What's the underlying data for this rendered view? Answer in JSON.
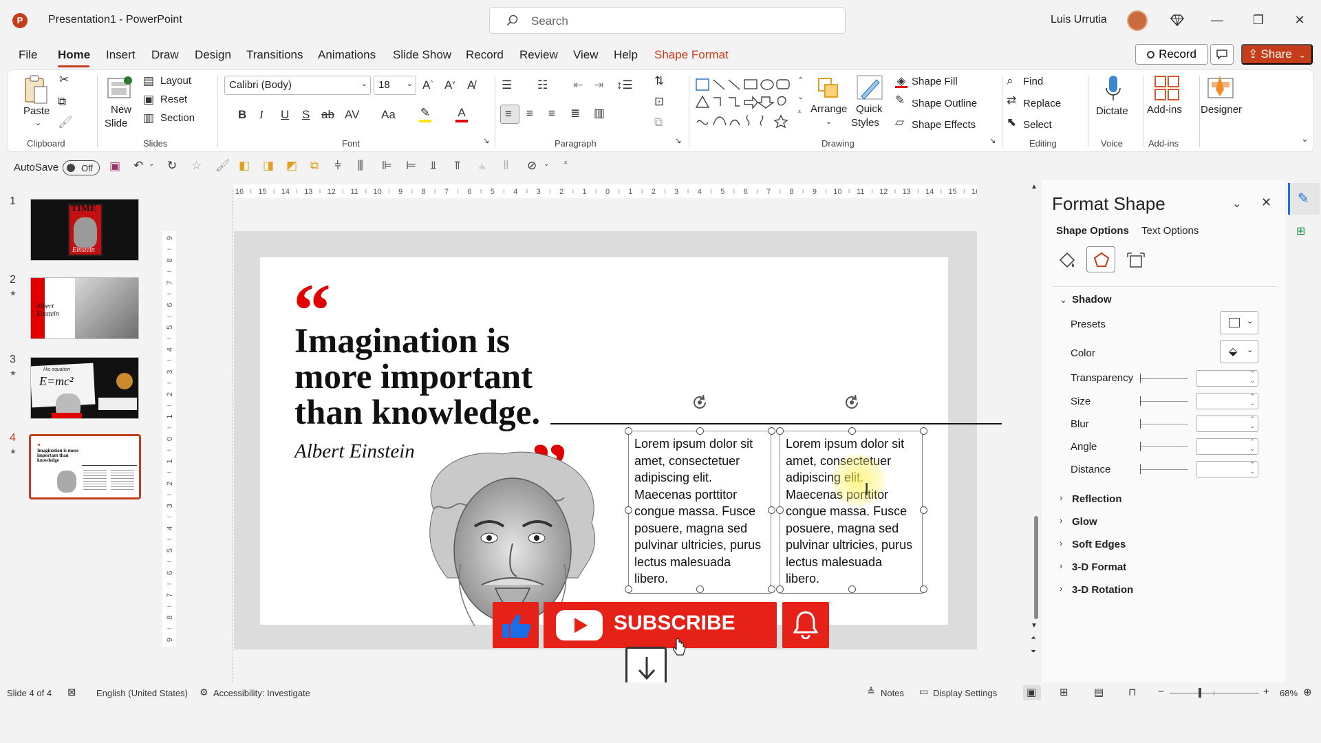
{
  "app": {
    "title": "Presentation1  -  PowerPoint",
    "search_placeholder": "Search",
    "user": "Luis Urrutia"
  },
  "window": {
    "minimize": "—",
    "restore": "❐",
    "close": "✕"
  },
  "tabs": [
    "File",
    "Home",
    "Insert",
    "Draw",
    "Design",
    "Transitions",
    "Animations",
    "Slide Show",
    "Record",
    "Review",
    "View",
    "Help",
    "Shape Format"
  ],
  "tab_colors": {
    "active_underline": "#c43e1c",
    "shape_format": "#c43e1c"
  },
  "header_buttons": {
    "record": "Record",
    "share": "Share"
  },
  "ribbon": {
    "clipboard": {
      "paste": "Paste",
      "label": "Clipboard"
    },
    "slides": {
      "new_slide_1": "New",
      "new_slide_2": "Slide",
      "layout": "Layout",
      "reset": "Reset",
      "section": "Section",
      "label": "Slides"
    },
    "font": {
      "name": "Calibri (Body)",
      "size": "18",
      "label": "Font"
    },
    "paragraph": {
      "label": "Paragraph"
    },
    "drawing": {
      "arrange": "Arrange",
      "quick_styles_1": "Quick",
      "quick_styles_2": "Styles",
      "shape_fill": "Shape Fill",
      "shape_outline": "Shape Outline",
      "shape_effects": "Shape Effects",
      "label": "Drawing"
    },
    "editing": {
      "find": "Find",
      "replace": "Replace",
      "select": "Select",
      "label": "Editing"
    },
    "voice": {
      "dictate": "Dictate",
      "label": "Voice"
    },
    "addins": {
      "addins": "Add-ins",
      "label": "Add-ins"
    },
    "designer": {
      "designer": "Designer"
    }
  },
  "qat": {
    "autosave": "AutoSave",
    "toggle": "Off"
  },
  "ruler": {
    "top_ticks": [
      "16",
      "15",
      "14",
      "13",
      "12",
      "11",
      "10",
      "9",
      "8",
      "7",
      "6",
      "5",
      "4",
      "3",
      "2",
      "1",
      "0",
      "1",
      "2",
      "3",
      "4",
      "5",
      "6",
      "7",
      "8",
      "9",
      "10",
      "11",
      "12",
      "13",
      "14",
      "15",
      "16"
    ],
    "left_ticks": [
      "9",
      "8",
      "7",
      "6",
      "5",
      "4",
      "3",
      "2",
      "1",
      "0",
      "1",
      "2",
      "3",
      "4",
      "5",
      "6",
      "7",
      "8",
      "9"
    ]
  },
  "thumbnails": [
    {
      "num": "1",
      "star": ""
    },
    {
      "num": "2",
      "star": "★"
    },
    {
      "num": "3",
      "star": "★"
    },
    {
      "num": "4",
      "star": "★"
    }
  ],
  "thumb_text": {
    "t1_time": "TIME",
    "t1_name": "Einstein",
    "t2_name": "Albert Einstein",
    "t3_eq": "E=mc²",
    "t3_small": "His equation",
    "t4_quote": "Imagination is more important than knowledge"
  },
  "slide": {
    "quote_mark_open": "“",
    "quote_mark_close": "”",
    "quote_line1": "Imagination is",
    "quote_line2": "more important",
    "quote_line3": "than knowledge.",
    "author": "Albert Einstein",
    "textbox1": "Lorem ipsum dolor sit amet, consectetuer adipiscing elit. Maecenas porttitor congue massa. Fusce posuere, magna sed pulvinar ultricies, purus lectus malesuada libero.",
    "textbox2": "Lorem ipsum dolor sit amet, consectetuer adipiscing elit. Maecenas porttitor congue massa. Fusce posuere, magna sed pulvinar ultricies, purus lectus malesuada libero.",
    "accent_color": "#e00000"
  },
  "overlay": {
    "subscribe": "SUBSCRIBE",
    "color": "#e62117"
  },
  "format_pane": {
    "title": "Format Shape",
    "tab_shape": "Shape Options",
    "tab_text": "Text Options",
    "shadow": "Shadow",
    "presets": "Presets",
    "color": "Color",
    "transparency": "Transparency",
    "size": "Size",
    "blur": "Blur",
    "angle": "Angle",
    "distance": "Distance",
    "reflection": "Reflection",
    "glow": "Glow",
    "soft_edges": "Soft Edges",
    "format_3d": "3-D Format",
    "rotation_3d": "3-D Rotation"
  },
  "status": {
    "slide_count": "Slide 4 of 4",
    "language": "English (United States)",
    "accessibility": "Accessibility: Investigate",
    "notes": "Notes",
    "display": "Display Settings",
    "zoom_minus": "−",
    "zoom_plus": "+",
    "zoom": "68%"
  }
}
